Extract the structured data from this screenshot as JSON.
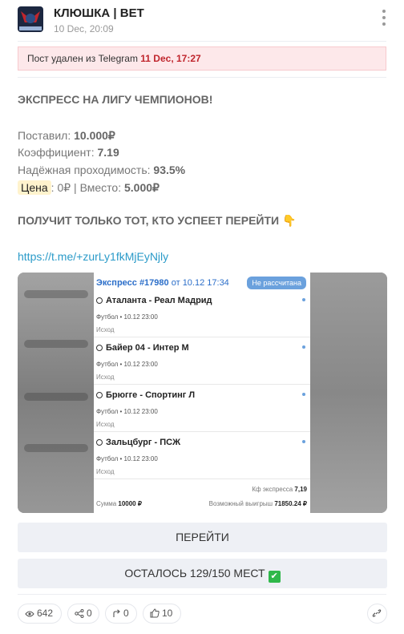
{
  "channel": {
    "title": "КЛЮШКА | BET",
    "date": "10 Dec, 20:09"
  },
  "deleted_notice": {
    "text": "Пост удален из Telegram",
    "date": "11 Dec, 17:27"
  },
  "post": {
    "heading": "ЭКСПРЕСС НА ЛИГУ ЧЕМПИОНОВ!",
    "placed_label": "Поставил:",
    "placed_value": "10.000₽",
    "coef_label": "Коэффициент:",
    "coef_value": "7.19",
    "pass_label": "Надёжная проходимость:",
    "pass_value": "93.5%",
    "price_label": "Цена",
    "price_value": ": 0₽",
    "instead_label": " | Вместо:",
    "instead_value": "5.000₽",
    "cta": "ПОЛУЧИТ ТОЛЬКО ТОТ, КТО УСПЕЕТ ПЕРЕЙТИ 👇",
    "link": "https://t.me/+zurLy1fkMjEyNjly"
  },
  "coupon": {
    "title": "Экспресс",
    "number": "#17980",
    "date_label": "от 10.12 17:34",
    "status": "Не рассчитана",
    "matches": [
      {
        "teams": "Аталанта - Реал Мадрид",
        "meta": "Футбол • 10.12 23:00",
        "outcome": "Исход"
      },
      {
        "teams": "Байер 04 - Интер М",
        "meta": "Футбол • 10.12 23:00",
        "outcome": "Исход"
      },
      {
        "teams": "Брюгге - Спортинг Л",
        "meta": "Футбол • 10.12 23:00",
        "outcome": "Исход"
      },
      {
        "teams": "Зальцбург - ПСЖ",
        "meta": "Футбол • 10.12 23:00",
        "outcome": "Исход"
      }
    ],
    "coef_label": "Кф экспресса",
    "coef_value": "7,19",
    "sum_label": "Сумма",
    "sum_value": "10000 ₽",
    "win_label": "Возможный выигрыш",
    "win_value": "71850.24 ₽"
  },
  "buttons": {
    "go": "ПЕРЕЙТИ",
    "seats": "ОСТАЛОСЬ 129/150 МЕСТ",
    "seats_icon": "✔"
  },
  "stats": {
    "views": "642",
    "shares": "0",
    "forwards": "0",
    "likes": "10"
  },
  "icons": [
    "avatar-logo",
    "more-vertical-icon",
    "eye-icon",
    "share-icon",
    "forward-icon",
    "thumbs-up-icon",
    "link-icon",
    "soccer-ball-icon",
    "checkmark-icon"
  ]
}
